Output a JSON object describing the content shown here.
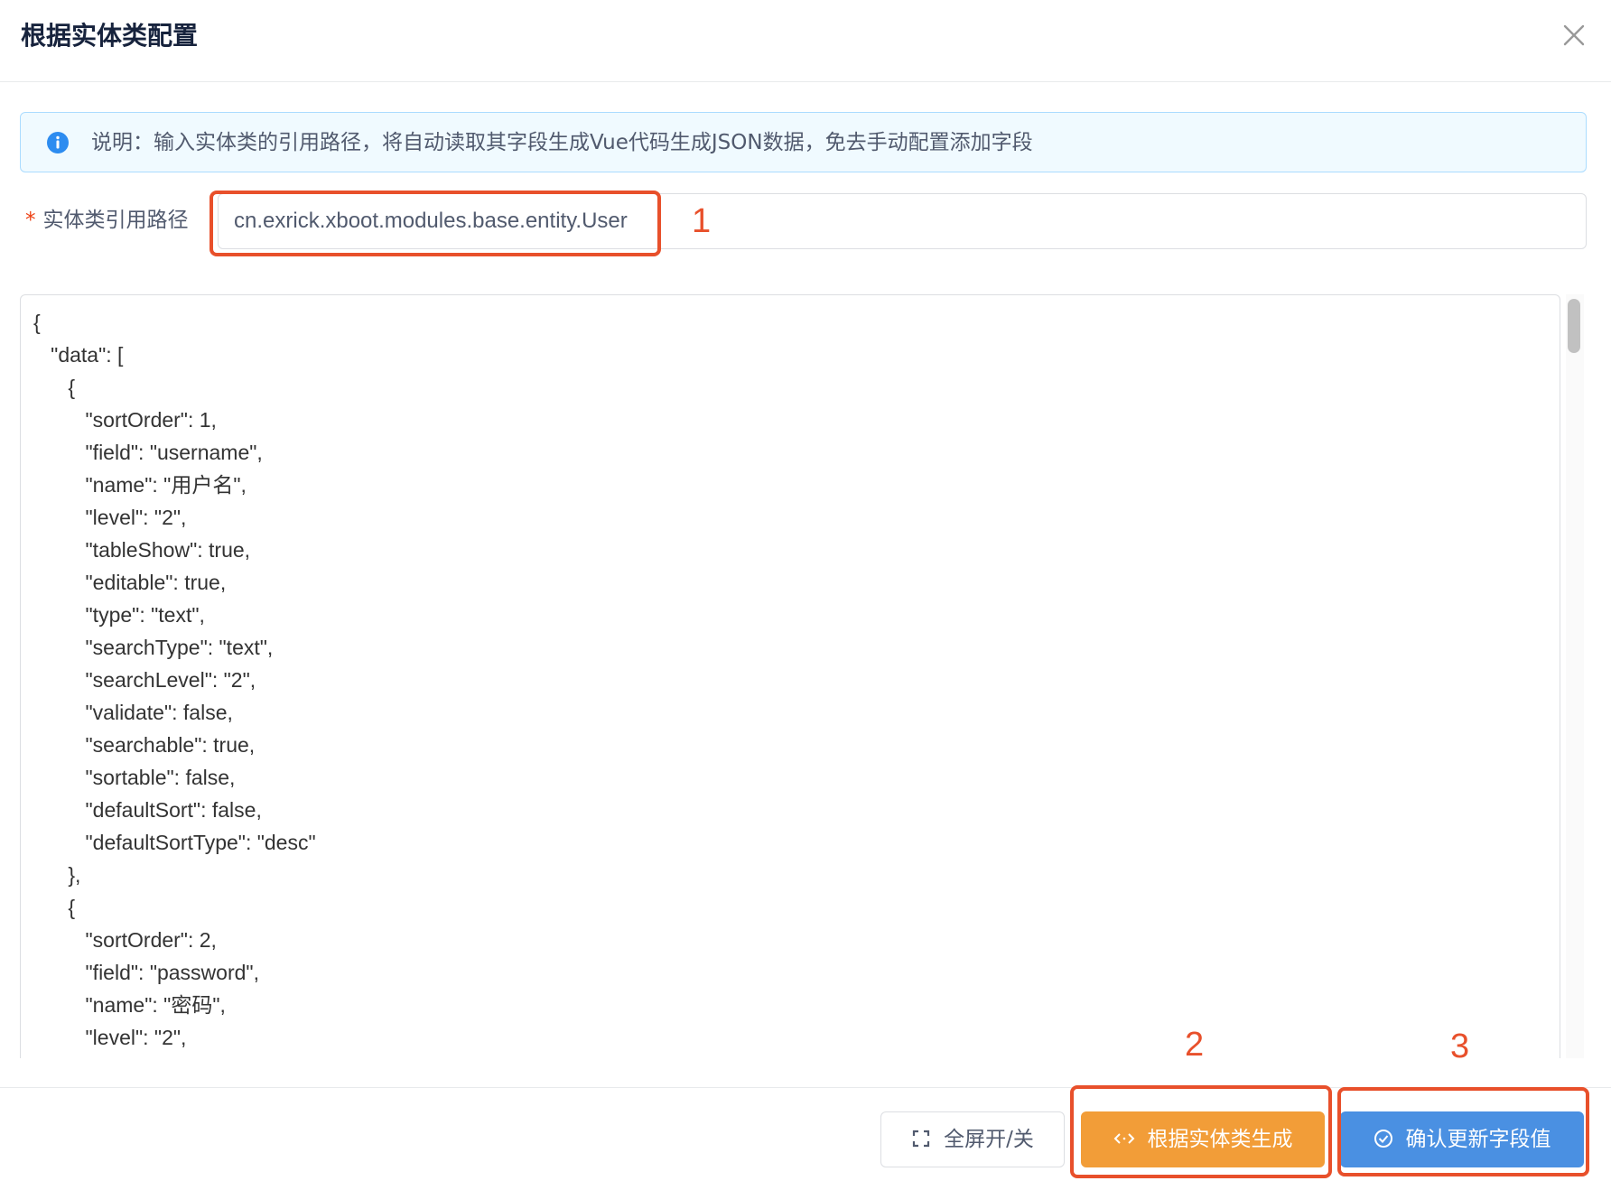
{
  "modal": {
    "title": "根据实体类配置"
  },
  "alert": {
    "text": "说明：输入实体类的引用路径，将自动读取其字段生成Vue代码生成JSON数据，免去手动配置添加字段"
  },
  "form": {
    "required_mark": "*",
    "label": "实体类引用路径",
    "value": "cn.exrick.xboot.modules.base.entity.User"
  },
  "code": {
    "content": "{\n   \"data\": [\n      {\n         \"sortOrder\": 1,\n         \"field\": \"username\",\n         \"name\": \"用户名\",\n         \"level\": \"2\",\n         \"tableShow\": true,\n         \"editable\": true,\n         \"type\": \"text\",\n         \"searchType\": \"text\",\n         \"searchLevel\": \"2\",\n         \"validate\": false,\n         \"searchable\": true,\n         \"sortable\": false,\n         \"defaultSort\": false,\n         \"defaultSortType\": \"desc\"\n      },\n      {\n         \"sortOrder\": 2,\n         \"field\": \"password\",\n         \"name\": \"密码\",\n         \"level\": \"2\","
  },
  "footer": {
    "fullscreen_label": "全屏开/关",
    "generate_label": "根据实体类生成",
    "confirm_label": "确认更新字段值"
  },
  "annotations": {
    "one": "1",
    "two": "2",
    "three": "3"
  },
  "icons": {
    "close": "close-icon",
    "info": "info-icon",
    "fullscreen": "fullscreen-icon",
    "code": "code-icon",
    "check": "check-circle-icon"
  },
  "colors": {
    "primary": "#4a90e2",
    "warning": "#f29d38",
    "annotation": "#e8502b",
    "alert_bg": "#f0faff",
    "alert_border": "#abdcff",
    "required": "#ed4014"
  }
}
